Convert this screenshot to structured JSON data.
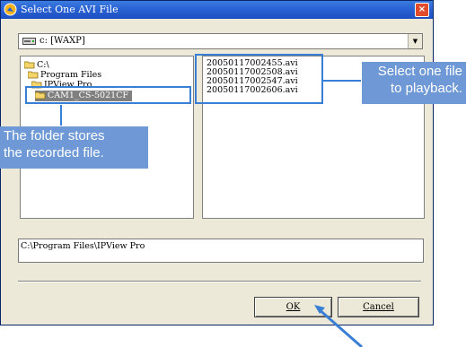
{
  "window": {
    "title": "Select One AVI File",
    "close_glyph": "×"
  },
  "drive_selector": {
    "value": "c: [WAXP]",
    "icon": "drive-icon"
  },
  "folder_tree": [
    {
      "label": "C:\\",
      "icon": "open-folder-icon",
      "selected": false
    },
    {
      "label": "Program Files",
      "icon": "open-folder-icon",
      "selected": false
    },
    {
      "label": "IPView Pro",
      "icon": "open-folder-icon",
      "selected": false
    },
    {
      "label": "CAM1_CS-5021CF",
      "icon": "open-folder-icon",
      "selected": true
    }
  ],
  "file_list": [
    "20050117002455.avi",
    "20050117002508.avi",
    "20050117002547.avi",
    "20050117002606.avi"
  ],
  "path_display": "C:\\Program Files\\IPView Pro",
  "buttons": {
    "ok": "OK",
    "cancel": "Cancel"
  },
  "annotations": {
    "folder_note": [
      "The folder stores",
      "the recorded file."
    ],
    "file_note": [
      "Select one file",
      "to playback."
    ]
  },
  "colors": {
    "annotation": "#3a7fd6",
    "annotation_label_bg": "#6f99d6",
    "titlebar": "#2a62d4"
  }
}
